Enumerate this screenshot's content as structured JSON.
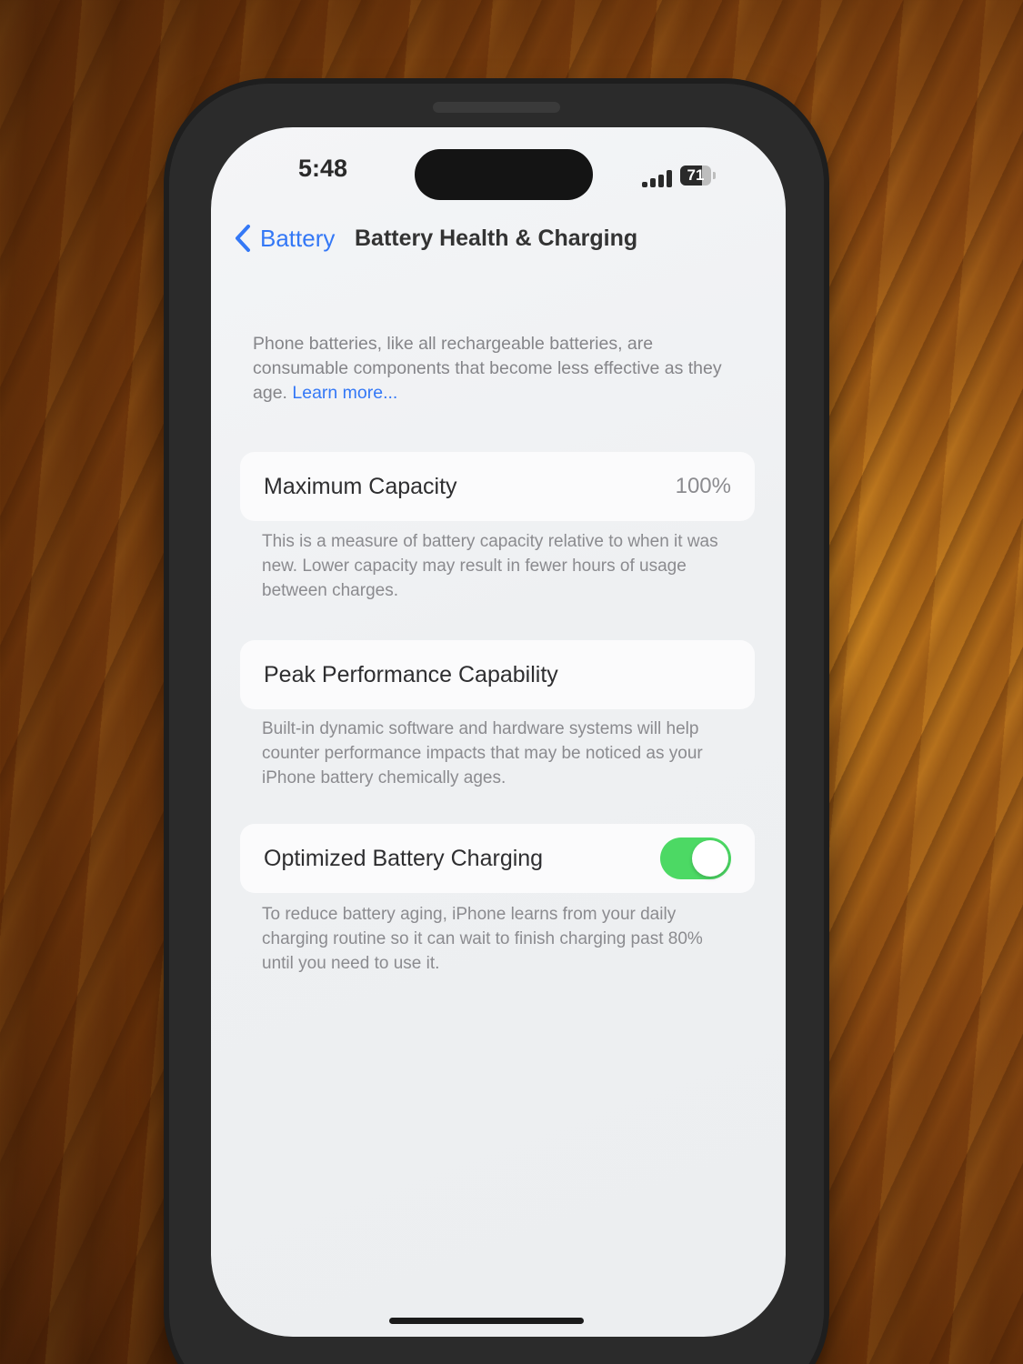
{
  "status_bar": {
    "time": "5:48",
    "battery_level": "71",
    "battery_fraction": 0.71,
    "signal_bars": 4
  },
  "nav": {
    "back_label": "Battery",
    "title": "Battery Health & Charging"
  },
  "intro": {
    "text": "Phone batteries, like all rechargeable batteries, are consumable components that become less effective as they age.",
    "link": "Learn more..."
  },
  "max_capacity": {
    "label": "Maximum Capacity",
    "value": "100%",
    "footnote": "This is a measure of battery capacity relative to when it was new. Lower capacity may result in fewer hours of usage between charges."
  },
  "peak_performance": {
    "label": "Peak Performance Capability",
    "footnote": "Built-in dynamic software and hardware systems will help counter performance impacts that may be noticed as your iPhone battery chemically ages."
  },
  "optimized_charging": {
    "label": "Optimized Battery Charging",
    "enabled": true,
    "footnote": "To reduce battery aging, iPhone learns from your daily charging routine so it can wait to finish charging past 80% until you need to use it."
  },
  "colors": {
    "accent": "#3478f6",
    "toggle_on": "#4cd964"
  }
}
